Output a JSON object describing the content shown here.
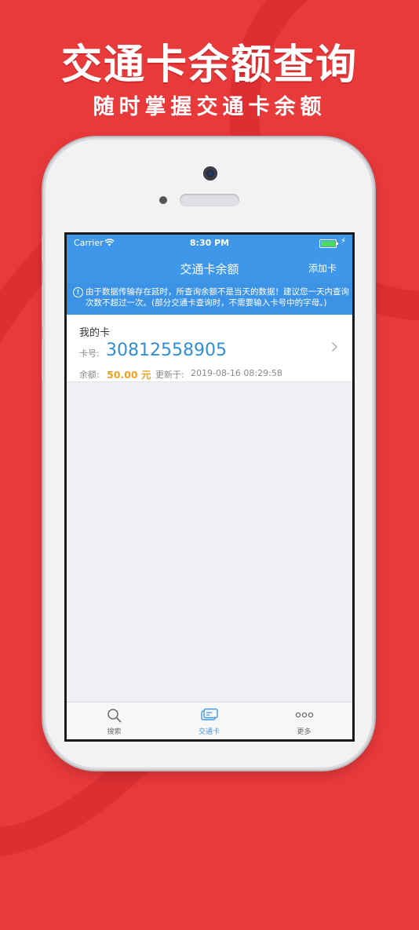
{
  "promo": {
    "title": "交通卡余额查询",
    "subtitle": "随时掌握交通卡余额"
  },
  "status_bar": {
    "carrier": "Carrier",
    "time": "8:30 PM"
  },
  "nav": {
    "title": "交通卡余额",
    "add_button": "添加卡"
  },
  "notice": {
    "text": "由于数据传输存在延时，所查询余额不是当天的数据！建议您一天内查询次数不超过一次。(部分交通卡查询时，不需要输入卡号中的字母。)"
  },
  "card": {
    "name": "我的卡",
    "number_label": "卡号:",
    "number": "30812558905",
    "balance_label": "余额:",
    "balance": "50.00 元",
    "updated_label": "更新于:",
    "updated": "2019-08-16 08:29:58"
  },
  "tabs": [
    {
      "label": "搜索",
      "icon": "search-icon",
      "active": false
    },
    {
      "label": "交通卡",
      "icon": "card-icon",
      "active": true
    },
    {
      "label": "更多",
      "icon": "more-icon",
      "active": false
    }
  ],
  "colors": {
    "background": "#e8393b",
    "nav_blue": "#3f97ea",
    "card_number": "#2f8fdb",
    "balance": "#f0a020"
  }
}
